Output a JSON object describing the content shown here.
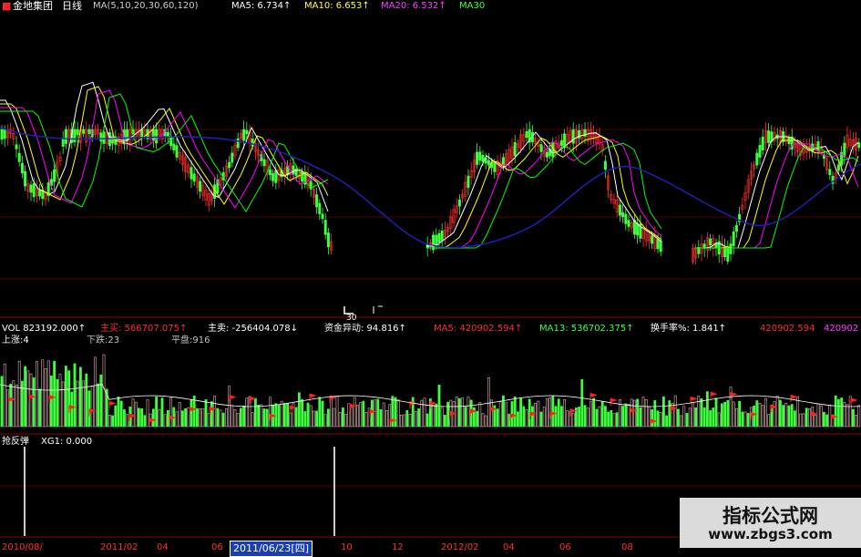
{
  "header": {
    "stock_name": "金地集团",
    "period": "日线",
    "ma_params": "MA(5,10,20,30,60,120)",
    "ma5": "MA5: 6.734↑",
    "ma10": "MA10: 6.653↑",
    "ma20": "MA20: 6.532↑",
    "ma30": "MA30"
  },
  "mid_marker": "30",
  "volume_header": {
    "vol": "VOL 823192.000↑",
    "zhumai": "主买: 566707.075↑",
    "zhumai2": "主卖: -256404.078↓",
    "zijin": "资金异动: 94.816↑",
    "ma5": "MA5: 420902.594↑",
    "ma13": "MA13: 536702.375↑",
    "huanshou": "换手率%: 1.841↑",
    "extra1": "420902.594",
    "extra2": "420902"
  },
  "stats": {
    "up": "上涨:4",
    "down": "下跌:23",
    "flat": "平盘:916"
  },
  "indicator": {
    "name": "抢反弹",
    "xg": "XG1: 0.000"
  },
  "axis_labels": [
    "2010/08/",
    "2011/02",
    "04",
    "06",
    "10",
    "12",
    "2012/02",
    "04",
    "06",
    "08"
  ],
  "selected_date": "2011/06/23[四]",
  "watermark": {
    "title": "指标公式网",
    "url": "www.zbgs3.com"
  },
  "colors": {
    "background": "#000000",
    "ma5": "#ffffff",
    "ma10": "#ffff00",
    "ma20": "#ff00ff",
    "ma30": "#00ff00",
    "ma60": "#2020c0",
    "up": "#ff3030",
    "down": "#3dff3d"
  }
}
